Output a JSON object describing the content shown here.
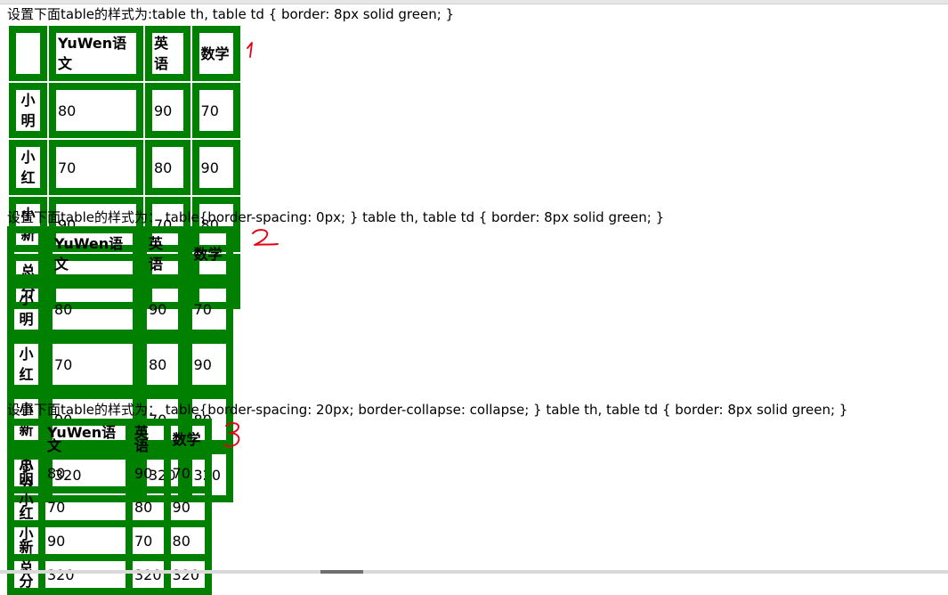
{
  "captions": {
    "c1": "设置下面table的样式为:table th, table td { border: 8px solid green; }",
    "c2": "设置下面table的样式为：  table{border-spacing: 0px; } table th, table td { border: 8px solid green; }",
    "c3": "设置下面table的样式为：  table{border-spacing: 20px; border-collapse: collapse; } table th, table td { border: 8px solid green; }"
  },
  "table": {
    "headers": [
      "",
      "YuWen语文",
      "英语",
      "数学"
    ],
    "rows": [
      {
        "name": "小明",
        "cells": [
          "80",
          "90",
          "70"
        ]
      },
      {
        "name": "小红",
        "cells": [
          "70",
          "80",
          "90"
        ]
      },
      {
        "name": "小新",
        "cells": [
          "90",
          "70",
          "80"
        ]
      },
      {
        "name": "总分",
        "cells": [
          "320",
          "320",
          "320"
        ]
      }
    ]
  },
  "annotations": {
    "a1": "1",
    "a2": "2",
    "a3": "3",
    "color": "#e60012"
  },
  "colors": {
    "border": "green"
  }
}
